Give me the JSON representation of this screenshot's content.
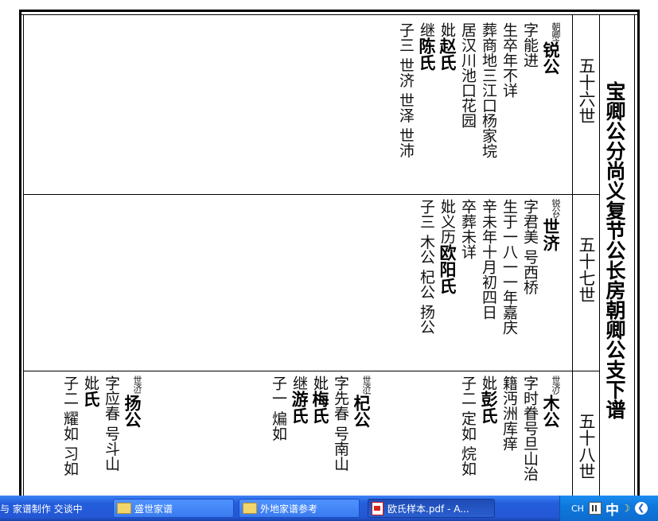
{
  "document": {
    "side_title": "宝卿公分尚义复节公长房朝卿公支下谱",
    "rows": [
      {
        "generation": "五十六世",
        "persons": [
          {
            "lines": [
              {
                "note": "朝卿之子",
                "name": "锐公"
              },
              {
                "text": "字能进"
              },
              {
                "text": "生卒年不详"
              },
              {
                "text": "葬商地三江口杨家垸"
              },
              {
                "text": "居汉川池口花园"
              },
              {
                "prefix": "妣",
                "name": "赵氏"
              },
              {
                "prefix": "继",
                "name": "陈氏"
              },
              {
                "text": "子三 世济 世泽 世沛"
              }
            ]
          }
        ]
      },
      {
        "generation": "五十七世",
        "persons": [
          {
            "lines": [
              {
                "note": "锐公长子",
                "name": "世济"
              },
              {
                "text": "字君美 号西桥"
              },
              {
                "text": "生于一八一一年嘉庆"
              },
              {
                "text": "辛未年十月初四日"
              },
              {
                "text": "卒葬未详"
              },
              {
                "text": "妣义历",
                "name": "欧阳氏"
              },
              {
                "text": "子三 木公 杞公 扬公"
              }
            ]
          }
        ]
      },
      {
        "generation": "五十八世",
        "persons": [
          {
            "lines": [
              {
                "note": "世济长子",
                "name": "木公"
              },
              {
                "text": "字时眷号旦山治"
              },
              {
                "text": "籍沔洲库痒"
              },
              {
                "prefix": "妣",
                "name": "彭氏"
              },
              {
                "text": "子二 定如 烷如"
              }
            ]
          },
          {
            "lines": [
              {
                "note": "世济次子",
                "name": "杞公"
              },
              {
                "text": "字先春 号南山"
              },
              {
                "prefix": "妣",
                "name": "梅氏"
              },
              {
                "prefix": "继",
                "name": "游氏"
              },
              {
                "text": "子一 煸如"
              }
            ]
          },
          {
            "lines": [
              {
                "note": "世济三子",
                "name": "扬公"
              },
              {
                "text": "字应春 号斗山"
              },
              {
                "prefix": "妣",
                "name": "氏"
              },
              {
                "text": "子二 耀如 习如"
              }
            ]
          }
        ]
      }
    ]
  },
  "taskbar": {
    "quick_launch_label": "与 家谱制作 交谈中",
    "items": [
      {
        "label": "盛世家谱",
        "icon": "folder-icon"
      },
      {
        "label": "外地家谱参考",
        "icon": "folder-icon"
      },
      {
        "label": "欧氏样本.pdf - A...",
        "icon": "pdf-icon",
        "active": true
      }
    ],
    "tray": {
      "language": "CH",
      "ime_label": "中"
    }
  }
}
